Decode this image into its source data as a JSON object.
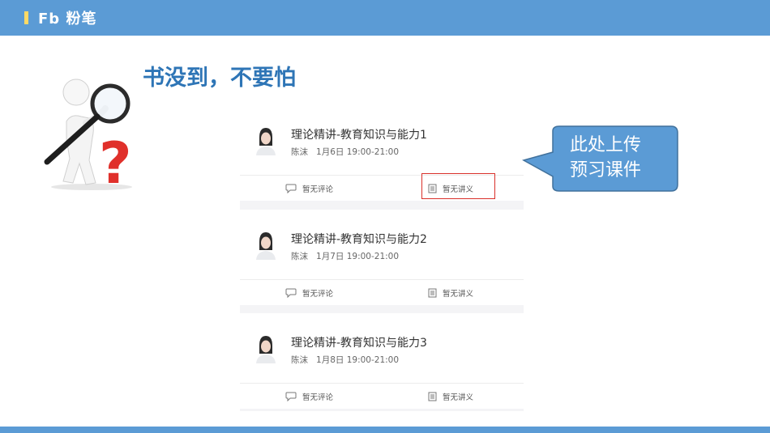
{
  "header": {
    "logo_text": "Fb 粉笔"
  },
  "title": "书没到，不要怕",
  "callout": {
    "line1": "此处上传",
    "line2": "预习课件"
  },
  "lessons": [
    {
      "title": "理论精讲-教育知识与能力1",
      "teacher": "陈沫",
      "schedule": "1月6日 19:00-21:00",
      "comment_label": "暂无评论",
      "notes_label": "暂无讲义"
    },
    {
      "title": "理论精讲-教育知识与能力2",
      "teacher": "陈沫",
      "schedule": "1月7日 19:00-21:00",
      "comment_label": "暂无评论",
      "notes_label": "暂无讲义"
    },
    {
      "title": "理论精讲-教育知识与能力3",
      "teacher": "陈沫",
      "schedule": "1月8日 19:00-21:00",
      "comment_label": "暂无评论",
      "notes_label": "暂无讲义"
    }
  ],
  "colors": {
    "brand_blue": "#5b9bd5",
    "title_blue": "#2e75b6",
    "accent_yellow": "#ffd966",
    "highlight_red": "#d9302a"
  },
  "icons": {
    "comment": "comment-bubble-icon",
    "notes": "document-icon",
    "figure": "magnifier-question-figure"
  }
}
